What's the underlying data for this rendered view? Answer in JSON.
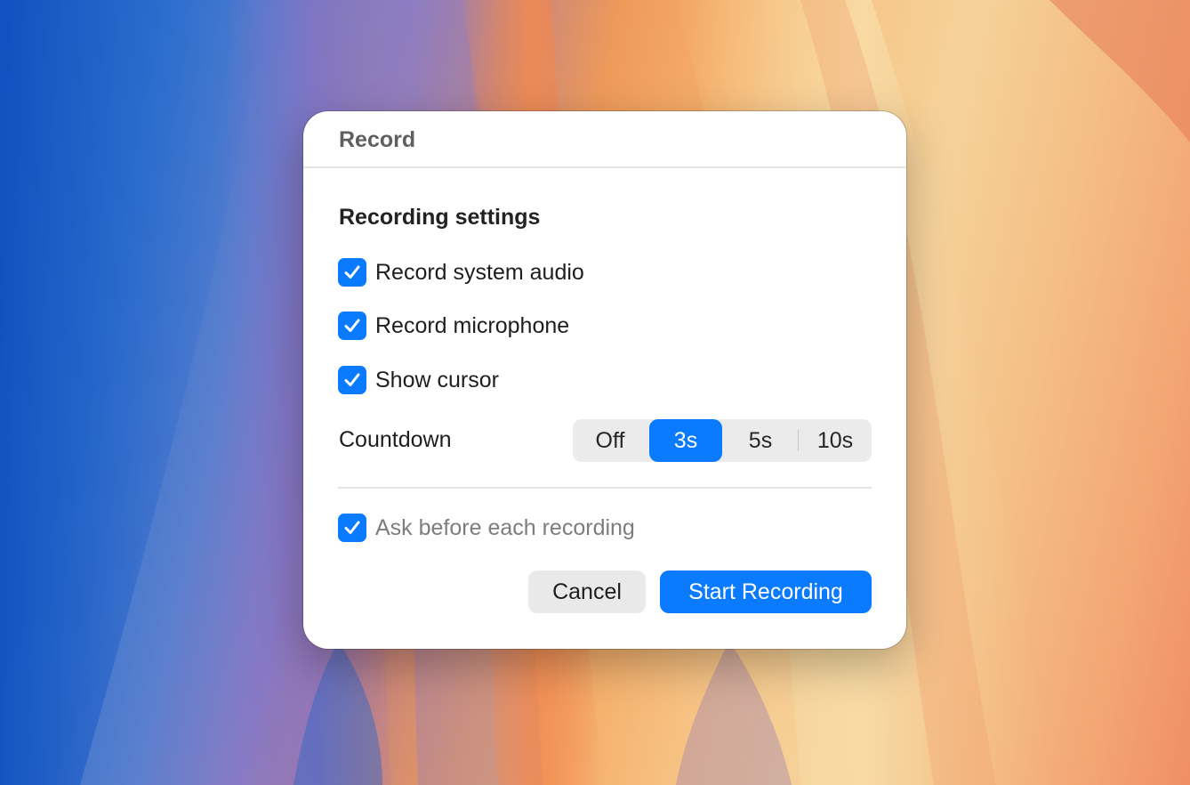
{
  "dialog": {
    "title": "Record",
    "section_heading": "Recording settings",
    "options": [
      {
        "label": "Record system audio",
        "checked": true
      },
      {
        "label": "Record microphone",
        "checked": true
      },
      {
        "label": "Show cursor",
        "checked": true
      }
    ],
    "countdown": {
      "label": "Countdown",
      "segments": [
        "Off",
        "3s",
        "5s",
        "10s"
      ],
      "selected": "3s"
    },
    "ask_before": {
      "label": "Ask before each recording",
      "checked": true
    },
    "buttons": {
      "cancel": "Cancel",
      "start": "Start Recording"
    }
  },
  "colors": {
    "accent": "#0a7aff",
    "dialog_bg": "#ffffff",
    "segment_bg": "#ebebeb",
    "secondary_button_bg": "#e9e9e9"
  },
  "icons": {
    "checkbox": "checkmark-icon"
  }
}
